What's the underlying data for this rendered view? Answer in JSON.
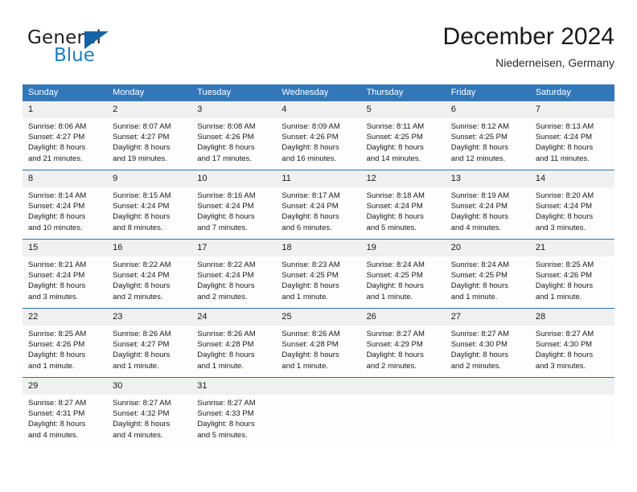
{
  "logo": {
    "word_one": "General",
    "word_two": "Blue",
    "triangle_icon": "blue-triangle-icon",
    "accent_color": "#1464a5",
    "blue_text_color": "#1f7cc0"
  },
  "header": {
    "title": "December 2024",
    "subtitle": "Niederneisen, Germany"
  },
  "theme": {
    "header_row_bg": "#3477b8",
    "header_row_text": "#ffffff",
    "daynum_bg": "#f0f0f0",
    "cell_bg": "#fdfdfd",
    "week_divider": "#2f6fab"
  },
  "weekday_headers": [
    "Sunday",
    "Monday",
    "Tuesday",
    "Wednesday",
    "Thursday",
    "Friday",
    "Saturday"
  ],
  "weeks": [
    [
      {
        "day": "1",
        "sunrise": "Sunrise: 8:06 AM",
        "sunset": "Sunset: 4:27 PM",
        "daylight_line1": "Daylight: 8 hours",
        "daylight_line2": "and 21 minutes."
      },
      {
        "day": "2",
        "sunrise": "Sunrise: 8:07 AM",
        "sunset": "Sunset: 4:27 PM",
        "daylight_line1": "Daylight: 8 hours",
        "daylight_line2": "and 19 minutes."
      },
      {
        "day": "3",
        "sunrise": "Sunrise: 8:08 AM",
        "sunset": "Sunset: 4:26 PM",
        "daylight_line1": "Daylight: 8 hours",
        "daylight_line2": "and 17 minutes."
      },
      {
        "day": "4",
        "sunrise": "Sunrise: 8:09 AM",
        "sunset": "Sunset: 4:26 PM",
        "daylight_line1": "Daylight: 8 hours",
        "daylight_line2": "and 16 minutes."
      },
      {
        "day": "5",
        "sunrise": "Sunrise: 8:11 AM",
        "sunset": "Sunset: 4:25 PM",
        "daylight_line1": "Daylight: 8 hours",
        "daylight_line2": "and 14 minutes."
      },
      {
        "day": "6",
        "sunrise": "Sunrise: 8:12 AM",
        "sunset": "Sunset: 4:25 PM",
        "daylight_line1": "Daylight: 8 hours",
        "daylight_line2": "and 12 minutes."
      },
      {
        "day": "7",
        "sunrise": "Sunrise: 8:13 AM",
        "sunset": "Sunset: 4:24 PM",
        "daylight_line1": "Daylight: 8 hours",
        "daylight_line2": "and 11 minutes."
      }
    ],
    [
      {
        "day": "8",
        "sunrise": "Sunrise: 8:14 AM",
        "sunset": "Sunset: 4:24 PM",
        "daylight_line1": "Daylight: 8 hours",
        "daylight_line2": "and 10 minutes."
      },
      {
        "day": "9",
        "sunrise": "Sunrise: 8:15 AM",
        "sunset": "Sunset: 4:24 PM",
        "daylight_line1": "Daylight: 8 hours",
        "daylight_line2": "and 8 minutes."
      },
      {
        "day": "10",
        "sunrise": "Sunrise: 8:16 AM",
        "sunset": "Sunset: 4:24 PM",
        "daylight_line1": "Daylight: 8 hours",
        "daylight_line2": "and 7 minutes."
      },
      {
        "day": "11",
        "sunrise": "Sunrise: 8:17 AM",
        "sunset": "Sunset: 4:24 PM",
        "daylight_line1": "Daylight: 8 hours",
        "daylight_line2": "and 6 minutes."
      },
      {
        "day": "12",
        "sunrise": "Sunrise: 8:18 AM",
        "sunset": "Sunset: 4:24 PM",
        "daylight_line1": "Daylight: 8 hours",
        "daylight_line2": "and 5 minutes."
      },
      {
        "day": "13",
        "sunrise": "Sunrise: 8:19 AM",
        "sunset": "Sunset: 4:24 PM",
        "daylight_line1": "Daylight: 8 hours",
        "daylight_line2": "and 4 minutes."
      },
      {
        "day": "14",
        "sunrise": "Sunrise: 8:20 AM",
        "sunset": "Sunset: 4:24 PM",
        "daylight_line1": "Daylight: 8 hours",
        "daylight_line2": "and 3 minutes."
      }
    ],
    [
      {
        "day": "15",
        "sunrise": "Sunrise: 8:21 AM",
        "sunset": "Sunset: 4:24 PM",
        "daylight_line1": "Daylight: 8 hours",
        "daylight_line2": "and 3 minutes."
      },
      {
        "day": "16",
        "sunrise": "Sunrise: 8:22 AM",
        "sunset": "Sunset: 4:24 PM",
        "daylight_line1": "Daylight: 8 hours",
        "daylight_line2": "and 2 minutes."
      },
      {
        "day": "17",
        "sunrise": "Sunrise: 8:22 AM",
        "sunset": "Sunset: 4:24 PM",
        "daylight_line1": "Daylight: 8 hours",
        "daylight_line2": "and 2 minutes."
      },
      {
        "day": "18",
        "sunrise": "Sunrise: 8:23 AM",
        "sunset": "Sunset: 4:25 PM",
        "daylight_line1": "Daylight: 8 hours",
        "daylight_line2": "and 1 minute."
      },
      {
        "day": "19",
        "sunrise": "Sunrise: 8:24 AM",
        "sunset": "Sunset: 4:25 PM",
        "daylight_line1": "Daylight: 8 hours",
        "daylight_line2": "and 1 minute."
      },
      {
        "day": "20",
        "sunrise": "Sunrise: 8:24 AM",
        "sunset": "Sunset: 4:25 PM",
        "daylight_line1": "Daylight: 8 hours",
        "daylight_line2": "and 1 minute."
      },
      {
        "day": "21",
        "sunrise": "Sunrise: 8:25 AM",
        "sunset": "Sunset: 4:26 PM",
        "daylight_line1": "Daylight: 8 hours",
        "daylight_line2": "and 1 minute."
      }
    ],
    [
      {
        "day": "22",
        "sunrise": "Sunrise: 8:25 AM",
        "sunset": "Sunset: 4:26 PM",
        "daylight_line1": "Daylight: 8 hours",
        "daylight_line2": "and 1 minute."
      },
      {
        "day": "23",
        "sunrise": "Sunrise: 8:26 AM",
        "sunset": "Sunset: 4:27 PM",
        "daylight_line1": "Daylight: 8 hours",
        "daylight_line2": "and 1 minute."
      },
      {
        "day": "24",
        "sunrise": "Sunrise: 8:26 AM",
        "sunset": "Sunset: 4:28 PM",
        "daylight_line1": "Daylight: 8 hours",
        "daylight_line2": "and 1 minute."
      },
      {
        "day": "25",
        "sunrise": "Sunrise: 8:26 AM",
        "sunset": "Sunset: 4:28 PM",
        "daylight_line1": "Daylight: 8 hours",
        "daylight_line2": "and 1 minute."
      },
      {
        "day": "26",
        "sunrise": "Sunrise: 8:27 AM",
        "sunset": "Sunset: 4:29 PM",
        "daylight_line1": "Daylight: 8 hours",
        "daylight_line2": "and 2 minutes."
      },
      {
        "day": "27",
        "sunrise": "Sunrise: 8:27 AM",
        "sunset": "Sunset: 4:30 PM",
        "daylight_line1": "Daylight: 8 hours",
        "daylight_line2": "and 2 minutes."
      },
      {
        "day": "28",
        "sunrise": "Sunrise: 8:27 AM",
        "sunset": "Sunset: 4:30 PM",
        "daylight_line1": "Daylight: 8 hours",
        "daylight_line2": "and 3 minutes."
      }
    ],
    [
      {
        "day": "29",
        "sunrise": "Sunrise: 8:27 AM",
        "sunset": "Sunset: 4:31 PM",
        "daylight_line1": "Daylight: 8 hours",
        "daylight_line2": "and 4 minutes."
      },
      {
        "day": "30",
        "sunrise": "Sunrise: 8:27 AM",
        "sunset": "Sunset: 4:32 PM",
        "daylight_line1": "Daylight: 8 hours",
        "daylight_line2": "and 4 minutes."
      },
      {
        "day": "31",
        "sunrise": "Sunrise: 8:27 AM",
        "sunset": "Sunset: 4:33 PM",
        "daylight_line1": "Daylight: 8 hours",
        "daylight_line2": "and 5 minutes."
      },
      {
        "day": "",
        "sunrise": "",
        "sunset": "",
        "daylight_line1": "",
        "daylight_line2": ""
      },
      {
        "day": "",
        "sunrise": "",
        "sunset": "",
        "daylight_line1": "",
        "daylight_line2": ""
      },
      {
        "day": "",
        "sunrise": "",
        "sunset": "",
        "daylight_line1": "",
        "daylight_line2": ""
      },
      {
        "day": "",
        "sunrise": "",
        "sunset": "",
        "daylight_line1": "",
        "daylight_line2": ""
      }
    ]
  ]
}
